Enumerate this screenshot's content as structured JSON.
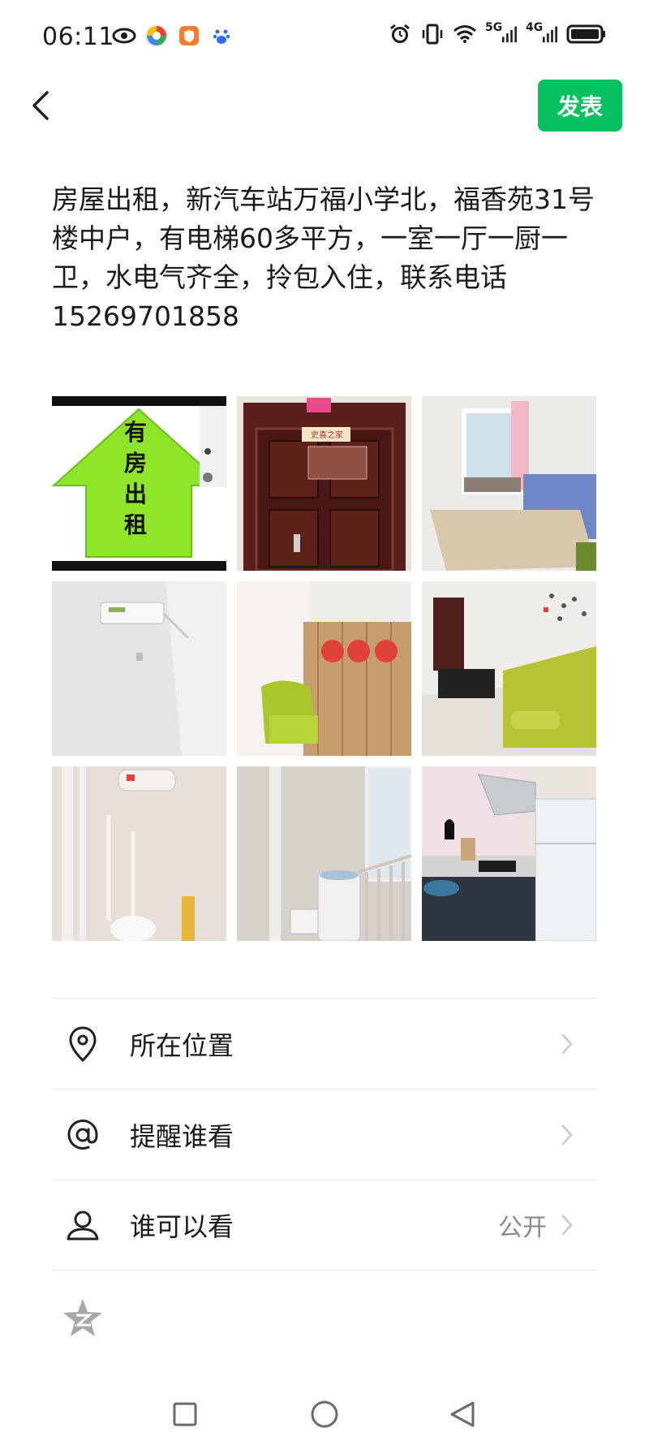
{
  "status_bar": {
    "time": "06:11",
    "signal_5g": "5G",
    "signal_4g": "4G"
  },
  "header": {
    "back_icon": "chevron-left-icon",
    "publish_label": "发表",
    "accent_color": "#07c160"
  },
  "post": {
    "text": "房屋出租，新汽车站万福小学北，福香苑31号楼中户，有电梯60多平方，一室一厅一厨一卫，水电气齐全，拎包入住，联系电话15269701858"
  },
  "photos": [
    {
      "label_lines": [
        "有",
        "房",
        "出",
        "租"
      ]
    },
    {
      "sign": "史喜之家"
    },
    {},
    {},
    {},
    {},
    {},
    {},
    {}
  ],
  "options": [
    {
      "icon": "location-pin-icon",
      "label": "所在位置",
      "value": ""
    },
    {
      "icon": "at-icon",
      "label": "提醒谁看",
      "value": ""
    },
    {
      "icon": "person-icon",
      "label": "谁可以看",
      "value": "公开"
    }
  ],
  "nav": {
    "recents_icon": "square-icon",
    "home_icon": "circle-icon",
    "back_icon": "triangle-back-icon"
  }
}
